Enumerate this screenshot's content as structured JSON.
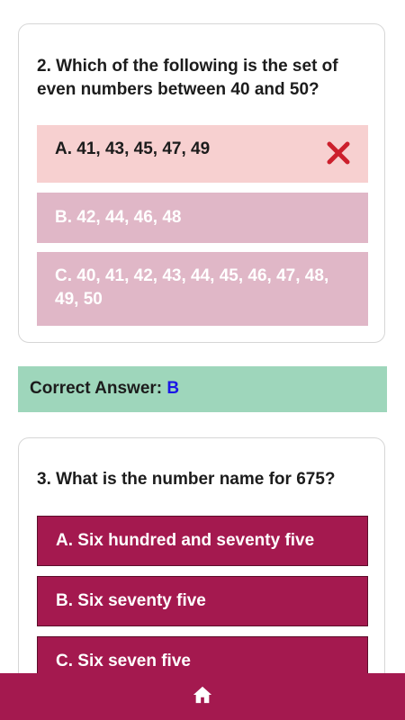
{
  "question2": {
    "text": "2. Which of the following is the set of even numbers between 40 and 50?",
    "options": [
      {
        "label": "A. 41, 43, 45, 47, 49",
        "state": "wrong"
      },
      {
        "label": "B. 42, 44, 46, 48",
        "state": "muted"
      },
      {
        "label": "C. 40, 41, 42, 43, 44, 45, 46, 47, 48, 49, 50",
        "state": "muted"
      }
    ],
    "wrong_icon": "cross-icon"
  },
  "correct_answer": {
    "prefix": "Correct Answer: ",
    "letter": "B"
  },
  "question3": {
    "text": "3. What is the number name for 675?",
    "options": [
      {
        "label": "A. Six hundred and seventy five"
      },
      {
        "label": "B. Six seventy five"
      },
      {
        "label": "C. Six seven five"
      }
    ]
  },
  "bottom_nav": {
    "icon": "home-icon"
  },
  "colors": {
    "wrong_bg": "#f7d0d0",
    "muted_bg": "#e0b7c7",
    "active_bg": "#a4194f",
    "answer_bg": "#9ed6bb",
    "answer_letter": "#1a16e6",
    "cross": "#cc1f2c"
  }
}
